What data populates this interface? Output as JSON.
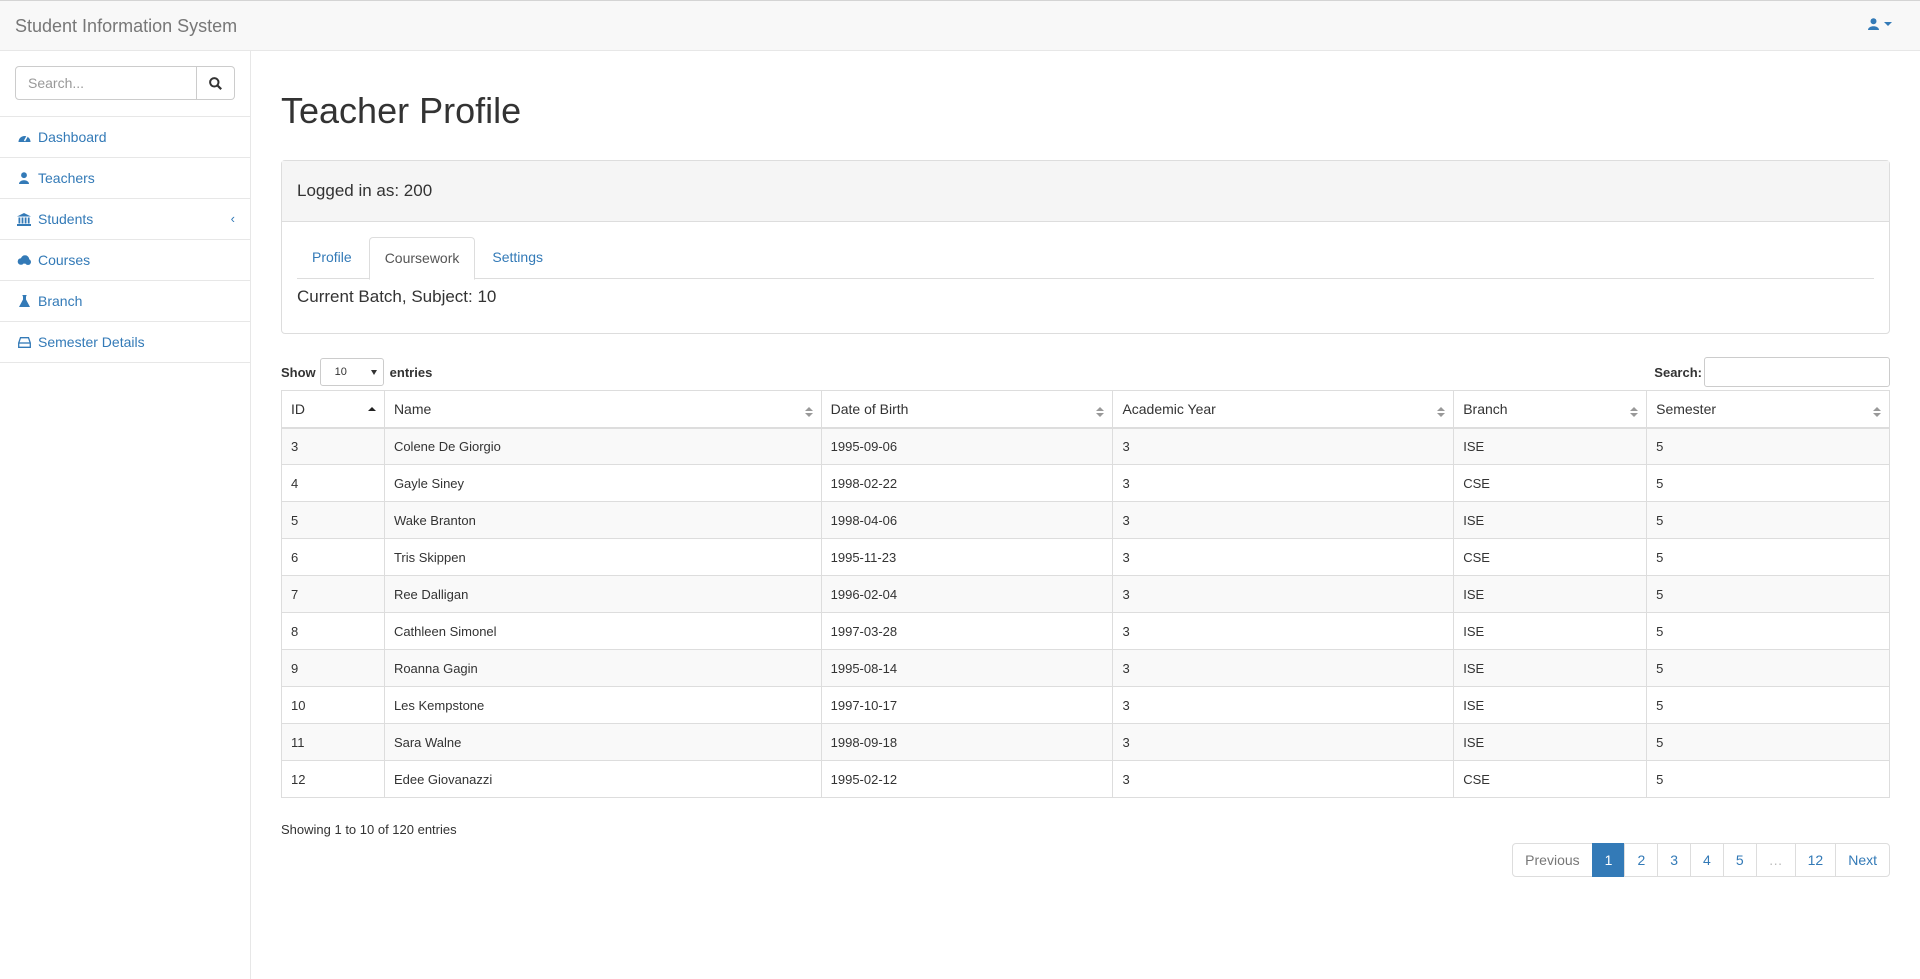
{
  "app": {
    "title": "Student Information System"
  },
  "search": {
    "placeholder": "Search..."
  },
  "sidebar": {
    "items": [
      {
        "label": "Dashboard",
        "icon": "dashboard-icon"
      },
      {
        "label": "Teachers",
        "icon": "user-icon"
      },
      {
        "label": "Students",
        "icon": "institution-icon",
        "has_arrow": true
      },
      {
        "label": "Courses",
        "icon": "cloud-icon"
      },
      {
        "label": "Branch",
        "icon": "flask-icon"
      },
      {
        "label": "Semester Details",
        "icon": "hdd-icon"
      }
    ]
  },
  "page": {
    "title": "Teacher Profile"
  },
  "panel": {
    "heading": "Logged in as: 200",
    "tabs": [
      "Profile",
      "Coursework",
      "Settings"
    ],
    "active_tab": "Coursework",
    "subject": "Current Batch, Subject: 10"
  },
  "datatable": {
    "show_label": "Show",
    "length_value": "10",
    "entries_label": "entries",
    "search_label": "Search:",
    "columns": [
      "ID",
      "Name",
      "Date of Birth",
      "Academic Year",
      "Branch",
      "Semester"
    ],
    "rows": [
      [
        "3",
        "Colene De Giorgio",
        "1995-09-06",
        "3",
        "ISE",
        "5"
      ],
      [
        "4",
        "Gayle Siney",
        "1998-02-22",
        "3",
        "CSE",
        "5"
      ],
      [
        "5",
        "Wake Branton",
        "1998-04-06",
        "3",
        "ISE",
        "5"
      ],
      [
        "6",
        "Tris Skippen",
        "1995-11-23",
        "3",
        "CSE",
        "5"
      ],
      [
        "7",
        "Ree Dalligan",
        "1996-02-04",
        "3",
        "ISE",
        "5"
      ],
      [
        "8",
        "Cathleen Simonel",
        "1997-03-28",
        "3",
        "ISE",
        "5"
      ],
      [
        "9",
        "Roanna Gagin",
        "1995-08-14",
        "3",
        "ISE",
        "5"
      ],
      [
        "10",
        "Les Kempstone",
        "1997-10-17",
        "3",
        "ISE",
        "5"
      ],
      [
        "11",
        "Sara Walne",
        "1998-09-18",
        "3",
        "ISE",
        "5"
      ],
      [
        "12",
        "Edee Giovanazzi",
        "1995-02-12",
        "3",
        "CSE",
        "5"
      ]
    ],
    "info": "Showing 1 to 10 of 120 entries",
    "pagination": [
      "Previous",
      "1",
      "2",
      "3",
      "4",
      "5",
      "…",
      "12",
      "Next"
    ],
    "active_page": "1"
  },
  "colors": {
    "link": "#337ab7",
    "active_page_bg": "#337ab7"
  }
}
